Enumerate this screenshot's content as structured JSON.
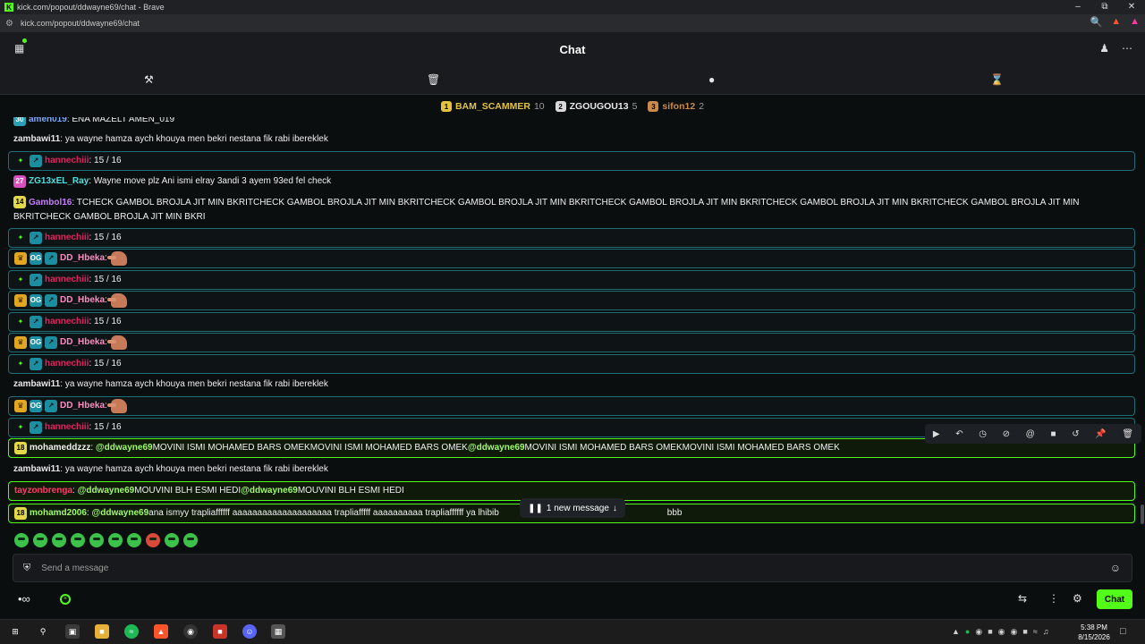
{
  "browser": {
    "window_title": "kick.com/popout/ddwayne69/chat - Brave",
    "url": "kick.com/popout/ddwayne69/chat"
  },
  "header": {
    "title": "Chat"
  },
  "leaderboard": [
    {
      "rank": "1",
      "user": "BAM_SCAMMER",
      "count": "10",
      "color": "#e3c23f"
    },
    {
      "rank": "2",
      "user": "ZGOUGOU13",
      "count": "5",
      "color": "#d9d9d9"
    },
    {
      "rank": "3",
      "user": "sifon12",
      "count": "2",
      "color": "#c98a4a"
    }
  ],
  "messages": {
    "m0": {
      "user": "amen019",
      "text": ": ENA MAZELT AMEN_019"
    },
    "m1": {
      "user": "zambawi11",
      "text": ": ya wayne hamza aych khouya men bekri nestana fik rabi ibereklek"
    },
    "m2": {
      "user": "hannechiii",
      "text": ": 15 / 16"
    },
    "m3": {
      "badge": "27",
      "user": "ZG13xEL_Ray",
      "text": ": Wayne move plz Ani ismi elray 3andi 3 ayem 93ed fel check"
    },
    "m4": {
      "badge": "14",
      "user": "Gambol16",
      "text": ": TCHECK GAMBOL BROJLA JIT MIN BKRITCHECK GAMBOL BROJLA JIT MIN BKRITCHECK GAMBOL BROJLA JIT MIN BKRITCHECK GAMBOL BROJLA JIT MIN BKRITCHECK GAMBOL BROJLA JIT MIN BKRITCHECK GAMBOL BROJLA JIT MIN BKRITCHECK GAMBOL BROJLA JIT MIN BKRI"
    },
    "m5": {
      "user": "hannechiii",
      "text": ": 15 / 16"
    },
    "m6": {
      "user": "DD_Hbeka",
      "text": ":"
    },
    "m7": {
      "user": "hannechiii",
      "text": ": 15 / 16"
    },
    "m8": {
      "user": "DD_Hbeka",
      "text": ":"
    },
    "m9": {
      "user": "hannechiii",
      "text": ": 15 / 16"
    },
    "m10": {
      "user": "DD_Hbeka",
      "text": ":"
    },
    "m11": {
      "user": "hannechiii",
      "text": ": 15 / 16"
    },
    "m12": {
      "user": "zambawi11",
      "text": ": ya wayne hamza aych khouya men bekri nestana fik rabi ibereklek"
    },
    "m13": {
      "user": "DD_Hbeka",
      "text": ":"
    },
    "m14": {
      "user": "hannechiii",
      "text": ": 15 / 16"
    },
    "m15": {
      "badge": "18",
      "user": "mohameddzzz",
      "sep": ":",
      "mention1": "@ddwayne69",
      "text1": " MOVINI ISMI MOHAMED BARS OMEKMOVINI ISMI MOHAMED BARS OMEK",
      "mention2": "@ddwayne69",
      "text2": " MOVINI ISMI MOHAMED BARS OMEKMOVINI ISMI MOHAMED BARS OMEK"
    },
    "m16": {
      "user": "zambawi11",
      "text": ": ya wayne hamza aych khouya men bekri nestana fik rabi ibereklek"
    },
    "m17": {
      "user": "tayzonbrenga",
      "sep": ":",
      "mention1": "@ddwayne69",
      "text1": " MOUVINI BLH ESMI HEDI",
      "mention2": "@ddwayne69",
      "text2": " MOUVINI BLH ESMI HEDI"
    },
    "m18": {
      "badge": "18",
      "user": "mohamd2006",
      "sep": ":",
      "mention1": "@ddwayne69",
      "text1": " ana ismyy trapliaffffff aaaaaaaaaaaaaaaaaaaa trapliafffff aaaaaaaaaa trapliaffffff ya lhibib",
      "tail": "bbb"
    }
  },
  "new_message_pill": "1 new message",
  "input": {
    "placeholder": "Send a message"
  },
  "chat_button": "Chat",
  "clock": {
    "time": "5:38 PM",
    "date": "8/15/2026"
  },
  "colors": {
    "kick_green": "#53fc18",
    "hannechiii": "#e0245e",
    "dd_hbeka": "#ff8ac0",
    "zambawi11": "#e8e8e8",
    "zg13": "#4ce0e0",
    "gambol16": "#c77dff",
    "mohameddzzz": "#f0f0f0",
    "tayzonbrenga": "#ff3b6b",
    "mohamd2006": "#9efc6a",
    "amen019": "#7aa8ff"
  }
}
